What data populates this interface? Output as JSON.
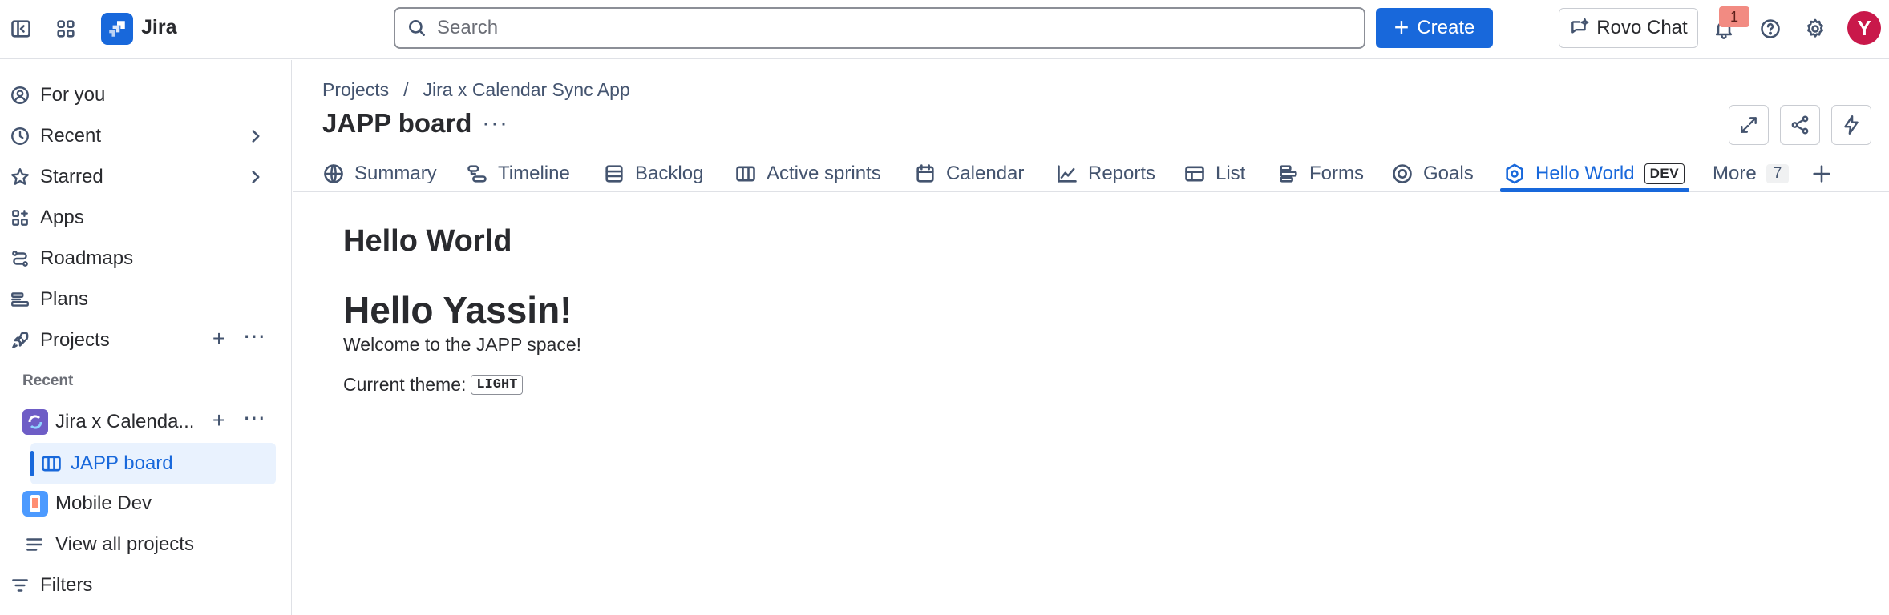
{
  "app": {
    "name": "Jira"
  },
  "topbar": {
    "search_placeholder": "Search",
    "create_label": "Create",
    "rovo_label": "Rovo Chat",
    "notification_count": "1",
    "avatar_initial": "Y"
  },
  "sidebar": {
    "items": [
      {
        "label": "For you",
        "icon": "user-circle-icon"
      },
      {
        "label": "Recent",
        "icon": "clock-icon"
      },
      {
        "label": "Starred",
        "icon": "star-icon"
      },
      {
        "label": "Apps",
        "icon": "apps-icon"
      },
      {
        "label": "Roadmaps",
        "icon": "roadmap-icon"
      },
      {
        "label": "Plans",
        "icon": "plans-icon"
      },
      {
        "label": "Projects",
        "icon": "rocket-icon"
      }
    ],
    "recent_heading": "Recent",
    "recent_projects": [
      {
        "label": "Jira x Calenda...",
        "color": "#6e5dc6"
      },
      {
        "label": "Mobile Dev",
        "color": "#4c9aff"
      }
    ],
    "active_board": "JAPP board",
    "view_all": "View all projects",
    "filters": "Filters"
  },
  "main": {
    "breadcrumb": [
      "Projects",
      "/",
      "Jira x Calendar Sync App"
    ],
    "board_title": "JAPP board",
    "tabs": [
      {
        "label": "Summary",
        "icon": "globe-icon"
      },
      {
        "label": "Timeline",
        "icon": "timeline-icon"
      },
      {
        "label": "Backlog",
        "icon": "backlog-icon"
      },
      {
        "label": "Active sprints",
        "icon": "board-icon"
      },
      {
        "label": "Calendar",
        "icon": "calendar-icon"
      },
      {
        "label": "Reports",
        "icon": "chart-icon"
      },
      {
        "label": "List",
        "icon": "list-icon"
      },
      {
        "label": "Forms",
        "icon": "forms-icon"
      },
      {
        "label": "Goals",
        "icon": "goal-icon"
      },
      {
        "label": "Hello World",
        "icon": "app-hex-icon",
        "lozenge": "DEV",
        "active": true
      },
      {
        "label": "More",
        "count": "7"
      }
    ],
    "content": {
      "page_heading": "Hello World",
      "greeting": "Hello Yassin!",
      "welcome": "Welcome to the JAPP space!",
      "theme_label": "Current theme:",
      "theme_value": "LIGHT"
    }
  },
  "colors": {
    "accent": "#1868db",
    "text": "#292a2e",
    "subtle": "#44546f",
    "selected_bg": "#e9f2fe"
  }
}
